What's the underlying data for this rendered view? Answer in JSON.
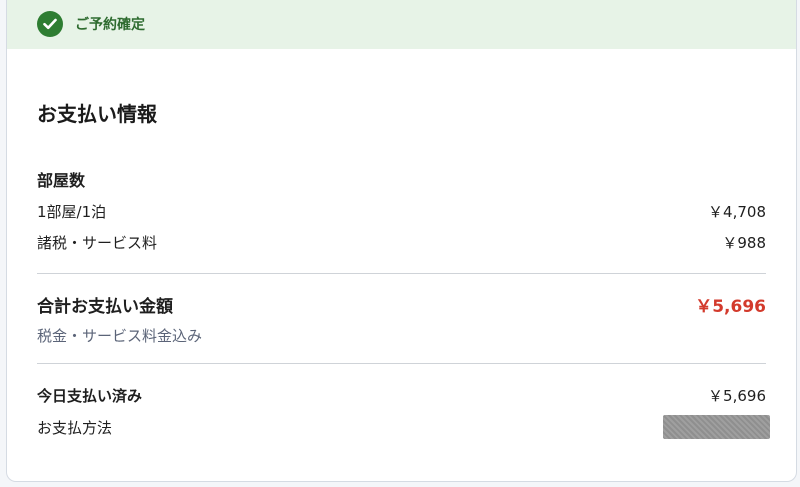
{
  "banner": {
    "text": "ご予約確定",
    "icon": "check-circle-icon",
    "color": "#2e7d32"
  },
  "payment": {
    "title": "お支払い情報",
    "rooms_heading": "部屋数",
    "line_items": [
      {
        "label": "1部屋/1泊",
        "amount": "￥4,708"
      },
      {
        "label": "諸税・サービス料",
        "amount": "￥988"
      }
    ],
    "total": {
      "label": "合計お支払い金額",
      "amount": "￥5,696",
      "note": "税金・サービス料金込み",
      "color": "#d33a2c"
    },
    "paid_today": {
      "label": "今日支払い済み",
      "amount": "￥5,696"
    },
    "payment_method": {
      "label": "お支払方法",
      "value_masked": true
    }
  }
}
